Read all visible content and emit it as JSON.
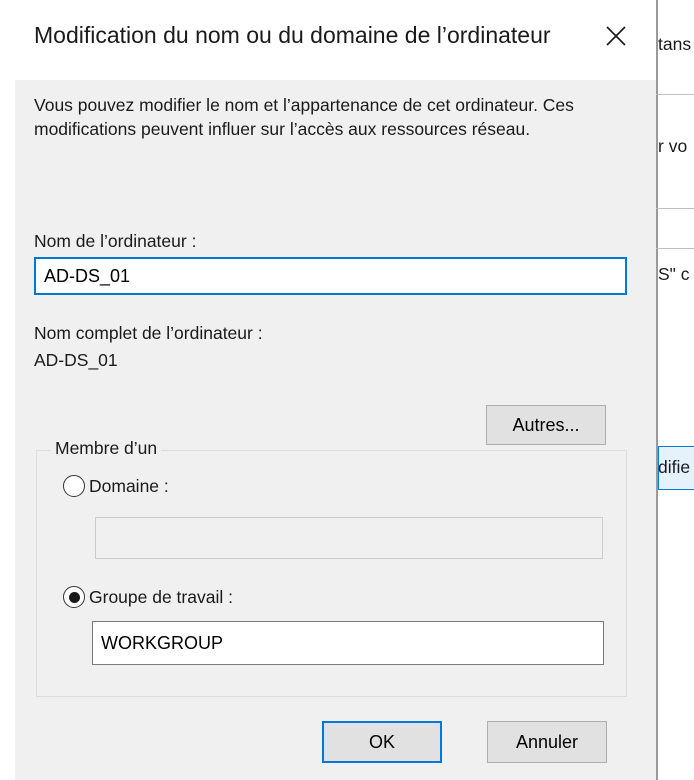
{
  "dialog": {
    "title": "Modification du nom ou du domaine de l’ordinateur",
    "description": "Vous pouvez modifier le nom et l’appartenance de cet ordinateur. Ces modifications peuvent influer sur l’accès aux ressources réseau.",
    "computer_name_label": "Nom de l’ordinateur :",
    "computer_name_value": "AD-DS_01",
    "full_name_label": "Nom complet de l’ordinateur :",
    "full_name_value": "AD-DS_01",
    "more_button": "Autres...",
    "member_of": {
      "legend": "Membre d’un",
      "domain_label": "Domaine :",
      "domain_value": "",
      "domain_selected": false,
      "workgroup_label": "Groupe de travail :",
      "workgroup_value": "WORKGROUP",
      "workgroup_selected": true
    },
    "ok_button": "OK",
    "cancel_button": "Annuler",
    "close_icon": "close-icon"
  },
  "background_window": {
    "fragments": [
      "tans",
      "r vo",
      "S\" c",
      "difie"
    ]
  },
  "colors": {
    "accent": "#0078d7",
    "dialog_background": "#f0f0f0",
    "button_face": "#e1e1e1"
  }
}
